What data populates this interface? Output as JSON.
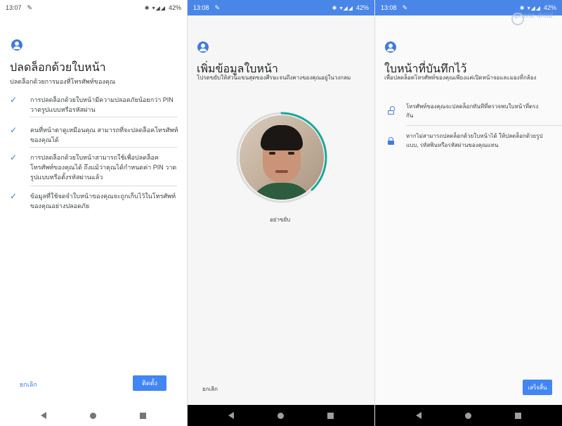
{
  "colors": {
    "accent": "#4285f4",
    "status_blue": "#4a86e8",
    "progress_ring": "#1aa89a"
  },
  "panel1": {
    "status": {
      "time": "13:07",
      "battery": "42%"
    },
    "title": "ปลดล็อกด้วยใบหน้า",
    "subtitle": "ปลดล็อกด้วยการมองที่โทรศัพท์ของคุณ",
    "benefits": [
      {
        "text": "การปลดล็อกด้วยใบหน้ามีความปลอดภัยน้อยกว่า PIN วาดรูปแบบหรือรหัสผ่าน",
        "icon": "check-icon"
      },
      {
        "text": "คนที่หน้าตาดูเหมือนคุณ สามารถที่จะปลดล็อคโทรศัพท์ของคุณได้",
        "icon": "check-icon"
      },
      {
        "text": "การปลดล็อกด้วยใบหน้าสามารถใช้เพื่อปลดล็อคโทรศัพท์ของคุณได้ ถึงแม้ว่าคุณได้กำหนดค่า PIN วาดรูปแบบหรือตั้งรหัสผ่านแล้ว",
        "icon": "check-icon"
      },
      {
        "text": "ข้อมูลที่ใช้จดจำใบหน้าของคุณจะถูกเก็บไว้ในโทรศัพท์ของคุณอย่างปลอดภัย",
        "icon": "check-icon"
      }
    ],
    "cancel_label": "ยกเลิก",
    "install_label": "ติดตั้ง"
  },
  "panel2": {
    "status": {
      "time": "13:08",
      "battery": "42%"
    },
    "title": "เพิ่มข้อมูลใบหน้า",
    "subtitle": "โปรดขยับให้ส่วนแขนสุดของศีรษะจนถึงคางของคุณอยู่ในวงกลม",
    "scan_progress": 0.38,
    "hint": "อย่าขยับ",
    "cancel_label": "ยกเลิก"
  },
  "panel3": {
    "status": {
      "time": "13:08",
      "battery": "42%"
    },
    "title": "ใบหน้าที่บันทึกไว้",
    "subtitle": "เพื่อปลดล็อคโทรศัพท์ของคุณเพียงแค่เปิดหน้าจอและมองที่กล้อง",
    "items": [
      {
        "text": "โทรศัพท์ของคุณจะปลดล็อกทันทีที่ตรวจพบใบหน้าที่ตรงกัน",
        "icon": "unlock-icon"
      },
      {
        "text": "หากไม่สามารถปลดล็อกด้วยใบหน้าได้ ให้ปลดล็อกด้วยรูปแบบ, รหัสพินหรือรหัสผ่านของคุณแทน",
        "icon": "lock-icon"
      }
    ],
    "done_label": "เสร็จสิ้น",
    "watermark": "iphone droid"
  }
}
